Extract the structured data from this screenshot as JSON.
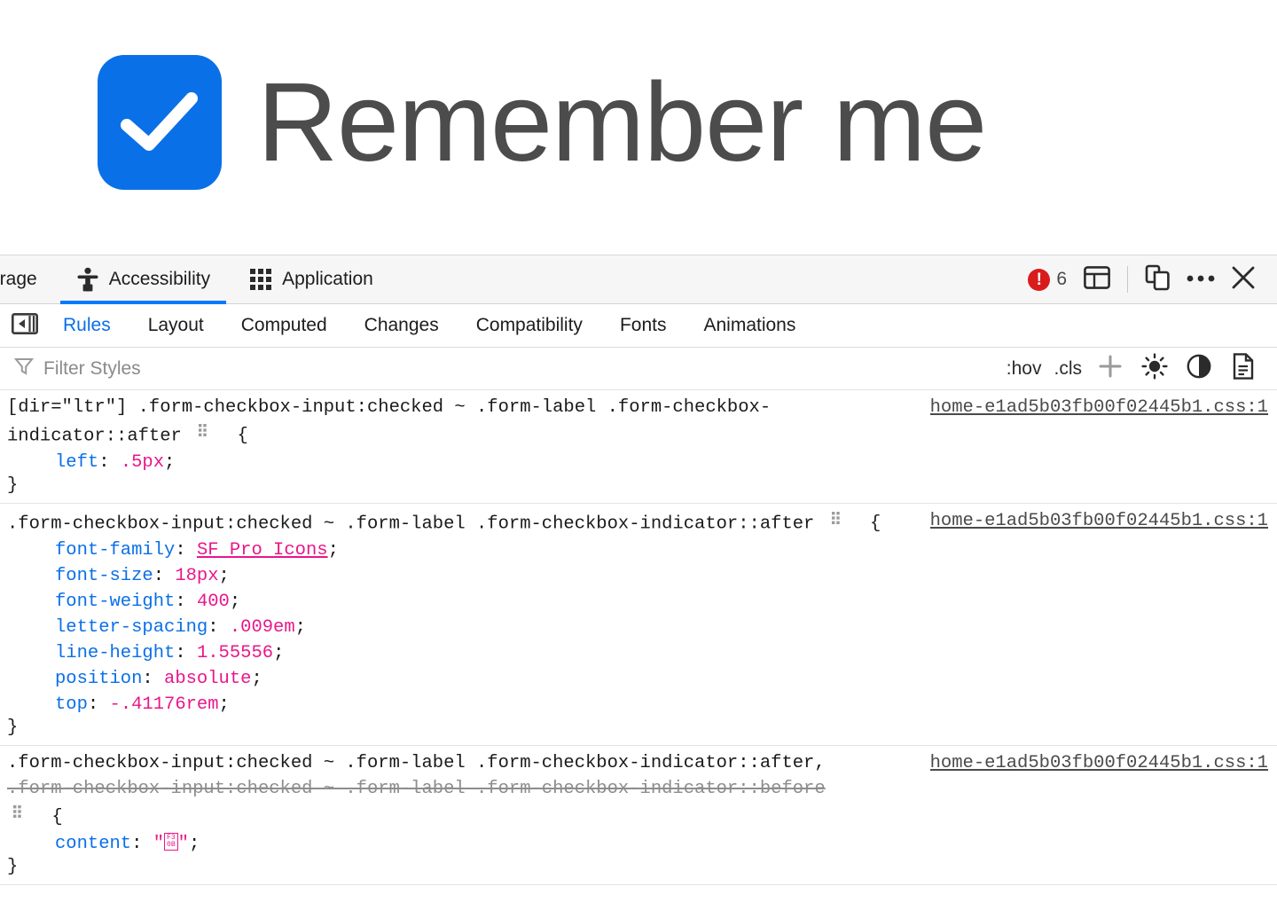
{
  "page": {
    "checkbox_icon": "checkmark-icon",
    "checkbox_color": "#0a70e8",
    "label": "Remember me",
    "label_color": "#4c4c4c"
  },
  "devtools": {
    "panel_tabs": [
      {
        "label": "orage",
        "icon": "storage-icon",
        "active": false,
        "clipped": true
      },
      {
        "label": "Accessibility",
        "icon": "accessibility-icon",
        "active": true,
        "clipped": false
      },
      {
        "label": "Application",
        "icon": "application-grid-icon",
        "active": false,
        "clipped": false
      }
    ],
    "toolbar": {
      "error_count": "6",
      "error_mark": "!",
      "error_color": "#d81c1c",
      "layout_toggle_icon": "panel-layout-icon",
      "device_icon": "responsive-design-mode-icon",
      "more_icon": "more-options-icon",
      "close_icon": "close-icon"
    },
    "sub_tabs": [
      {
        "label": "Rules",
        "active": true
      },
      {
        "label": "Layout",
        "active": false
      },
      {
        "label": "Computed",
        "active": false
      },
      {
        "label": "Changes",
        "active": false
      },
      {
        "label": "Compatibility",
        "active": false
      },
      {
        "label": "Fonts",
        "active": false
      },
      {
        "label": "Animations",
        "active": false
      }
    ],
    "sidebar_collapse_icon": "sidebar-collapse-icon",
    "filter_bar": {
      "icon": "filter-funnel-icon",
      "placeholder": "Filter Styles",
      "hov_label": ":hov",
      "cls_label": ".cls",
      "add_rule_icon": "plus-icon",
      "light_scheme_icon": "sun-icon",
      "dark_scheme_icon": "moon-icon",
      "print_media_icon": "document-icon"
    },
    "accent_blue": "#0a6fe8",
    "active_tab_underline": "#007aff"
  },
  "rules": [
    {
      "selector_lines": [
        {
          "text": "[dir=\"ltr\"] .form-checkbox-input:checked ~ .form-label .form-checkbox-indicator::after",
          "disabled": false
        }
      ],
      "source": "home-e1ad5b03fb00f02445b1.css:1",
      "declarations": [
        {
          "property": "left",
          "value": ".5px",
          "value_is_link": false
        }
      ]
    },
    {
      "selector_lines": [
        {
          "text": ".form-checkbox-input:checked ~ .form-label .form-checkbox-indicator::after",
          "disabled": false
        }
      ],
      "source": "home-e1ad5b03fb00f02445b1.css:1",
      "declarations": [
        {
          "property": "font-family",
          "value": "SF Pro Icons",
          "value_is_link": true
        },
        {
          "property": "font-size",
          "value": "18px",
          "value_is_link": false
        },
        {
          "property": "font-weight",
          "value": "400",
          "value_is_link": false
        },
        {
          "property": "letter-spacing",
          "value": ".009em",
          "value_is_link": false
        },
        {
          "property": "line-height",
          "value": "1.55556",
          "value_is_link": false
        },
        {
          "property": "position",
          "value": "absolute",
          "value_is_link": false
        },
        {
          "property": "top",
          "value": "-.41176rem",
          "value_is_link": false
        }
      ]
    },
    {
      "selector_lines": [
        {
          "text": ".form-checkbox-input:checked ~ .form-label .form-checkbox-indicator::after,",
          "disabled": false
        },
        {
          "text": ".form-checkbox-input:checked ~ .form-label .form-checkbox-indicator::before",
          "disabled": true
        }
      ],
      "source": "home-e1ad5b03fb00f02445b1.css:1",
      "declarations": [
        {
          "property": "content",
          "value": "\"□\"",
          "value_is_link": false,
          "is_tofu": true,
          "tofu_top": "F3",
          "tofu_bottom": "0B"
        }
      ]
    }
  ]
}
